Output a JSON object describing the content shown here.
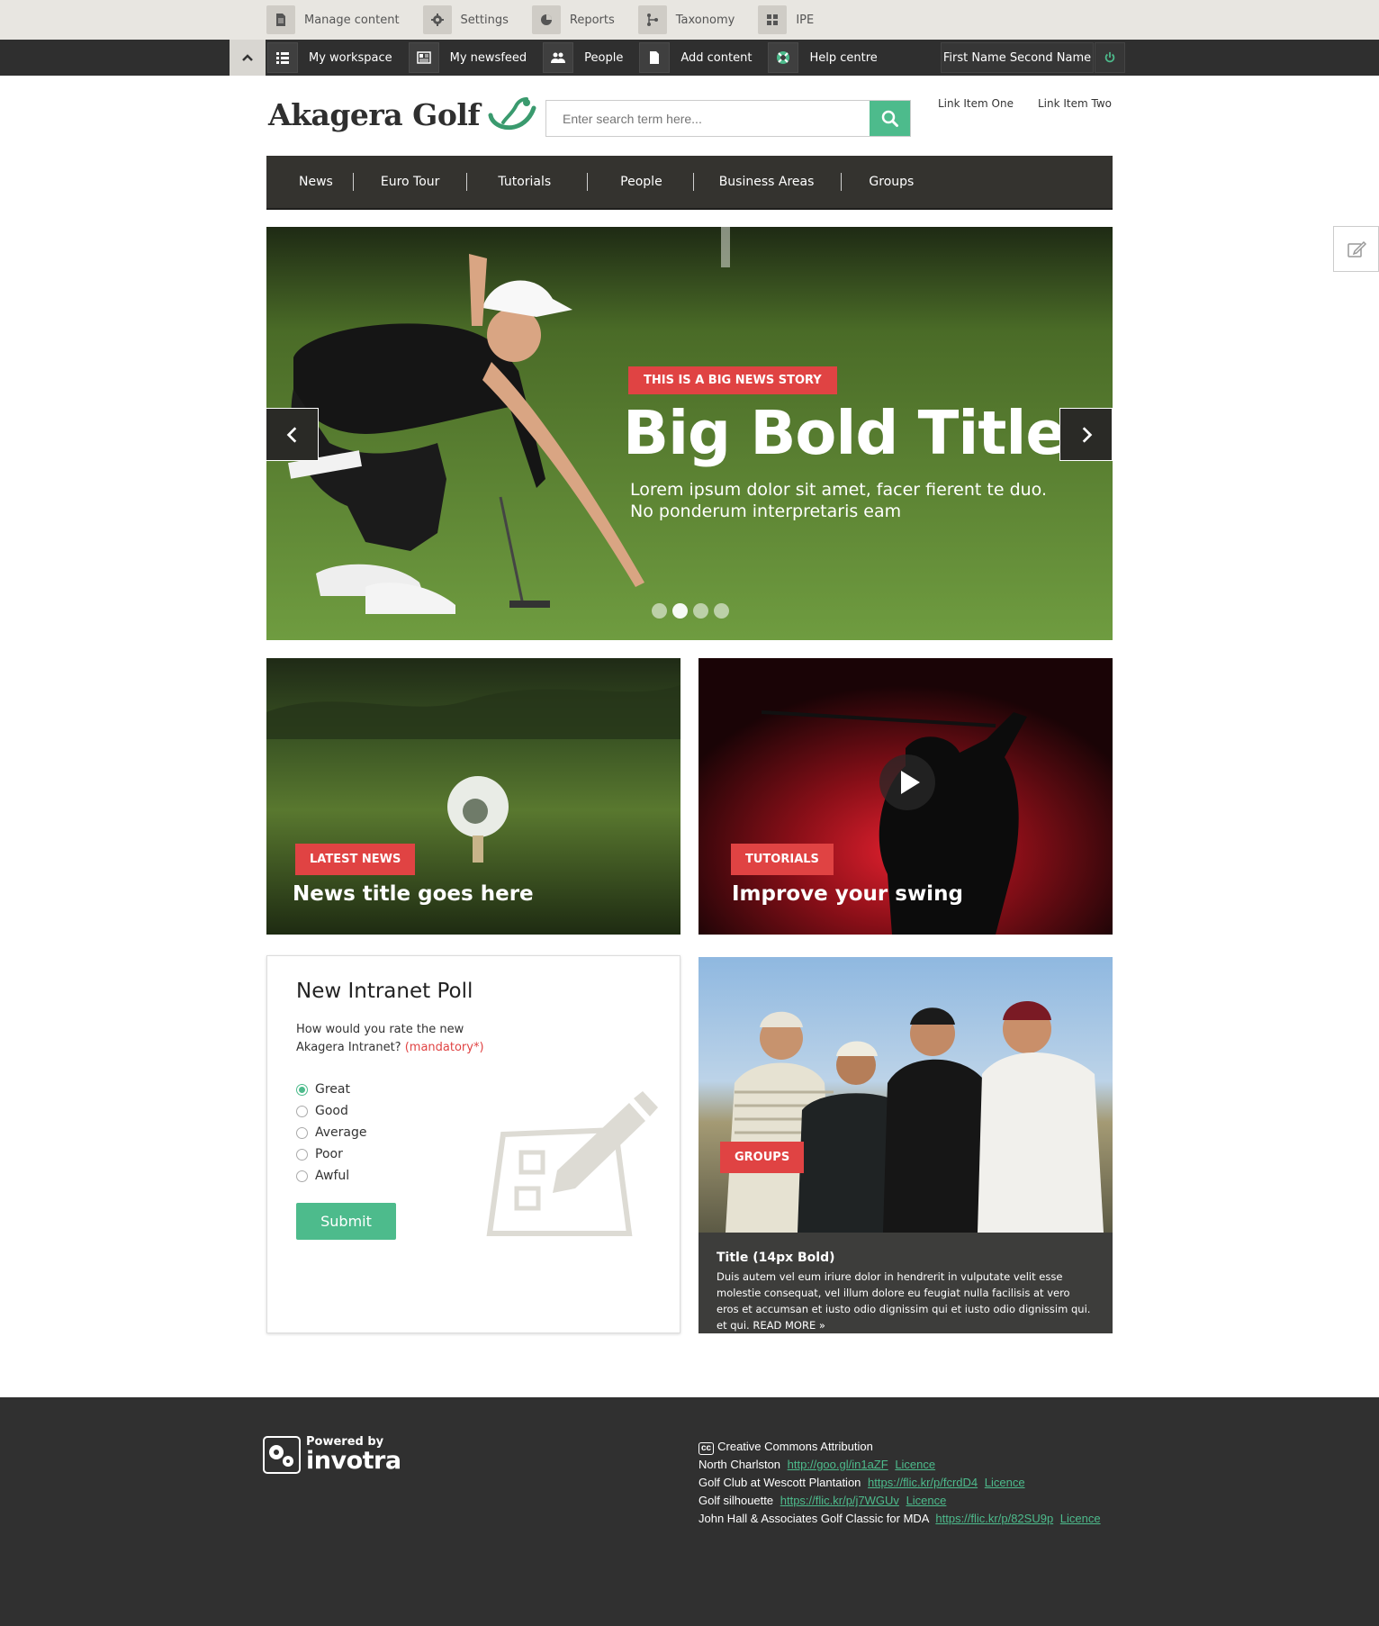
{
  "admin_bar": {
    "items": [
      {
        "label": "Manage content",
        "icon": "document-icon"
      },
      {
        "label": "Settings",
        "icon": "gear-icon"
      },
      {
        "label": "Reports",
        "icon": "pie-chart-icon"
      },
      {
        "label": "Taxonomy",
        "icon": "taxonomy-icon"
      },
      {
        "label": "IPE",
        "icon": "grid-icon"
      }
    ]
  },
  "toolbar": {
    "items": [
      {
        "label": "My workspace",
        "icon": "list-icon"
      },
      {
        "label": "My newsfeed",
        "icon": "newspaper-icon"
      },
      {
        "label": "People",
        "icon": "people-icon"
      },
      {
        "label": "Add content",
        "icon": "file-icon"
      },
      {
        "label": "Help centre",
        "icon": "lifebuoy-icon"
      }
    ],
    "user_name": "First Name Second Name"
  },
  "header": {
    "logo_text": "Akagera Golf",
    "search_placeholder": "Enter search term here...",
    "links": [
      "Link Item One",
      "Link Item Two"
    ]
  },
  "nav": {
    "items": [
      "News",
      "Euro Tour",
      "Tutorials",
      "People",
      "Business Areas",
      "Groups"
    ]
  },
  "hero": {
    "tag": "THIS IS A BIG NEWS STORY",
    "title": "Big Bold Title",
    "subtitle_line1": "Lorem ipsum dolor sit amet, facer fierent te duo.",
    "subtitle_line2": "No ponderum interpretaris eam",
    "slide_count": 4,
    "active_slide": 2
  },
  "cards": {
    "news": {
      "tag": "LATEST NEWS",
      "title": "News title goes here"
    },
    "tutorials": {
      "tag": "TUTORIALS",
      "title": "Improve your swing"
    }
  },
  "poll": {
    "title": "New Intranet Poll",
    "question_line1": "How would you rate the new",
    "question_line2": "Akagera Intranet?",
    "mandatory": "(mandatory*)",
    "options": [
      "Great",
      "Good",
      "Average",
      "Poor",
      "Awful"
    ],
    "selected": "Great",
    "submit_label": "Submit"
  },
  "groups": {
    "tag": "GROUPS",
    "title": "Title (14px Bold)",
    "text": "Duis autem vel eum iriure dolor in hendrerit in vulputate velit esse molestie consequat, vel illum dolore eu feugiat nulla facilisis at vero eros et accumsan et iusto odio dignissim qui et iusto odio dignissim qui. et qui.",
    "read_more": "READ MORE »"
  },
  "footer": {
    "powered_by": "Powered by",
    "brand": "invotra",
    "cc_badge": "cc",
    "cc_title": "Creative Commons Attribution",
    "credits": [
      {
        "name": "North Charlston",
        "url": "http://goo.gl/in1aZF",
        "licence": "Licence"
      },
      {
        "name": "Golf Club at Wescott Plantation",
        "url": "https://flic.kr/p/fcrdD4",
        "licence": "Licence"
      },
      {
        "name": "Golf silhouette",
        "url": "https://flic.kr/p/j7WGUv",
        "licence": "Licence"
      },
      {
        "name": "John Hall & Associates Golf Classic for MDA",
        "url": "https://flic.kr/p/82SU9p",
        "licence": "Licence"
      }
    ]
  },
  "colors": {
    "accent_green": "#4dbb8c",
    "tag_red": "#e04343",
    "dark": "#34332f"
  }
}
